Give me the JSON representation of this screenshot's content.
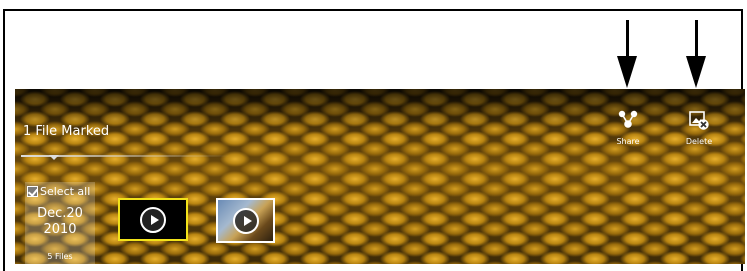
{
  "header": {
    "marked_label": "1 File Marked"
  },
  "actions": {
    "share_label": "Share",
    "delete_label": "Delete"
  },
  "date_group": {
    "select_all_label": "Select all",
    "select_all_checked": true,
    "month_day": "Dec.20",
    "year": "2010",
    "file_count": "5 Files"
  },
  "thumbnails": [
    {
      "icon": "play-icon",
      "selected": true
    },
    {
      "icon": "play-icon",
      "selected": false
    }
  ],
  "colors": {
    "selection_border": "#f2e31a",
    "background_accent": "#c8941a"
  }
}
